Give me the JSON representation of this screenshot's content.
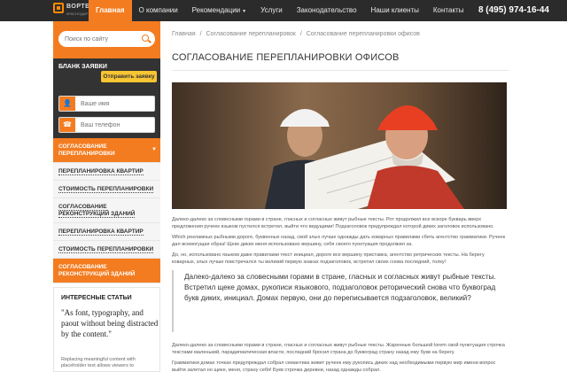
{
  "nav": {
    "brand": "ВОРТЕКС",
    "brand_sub": "КРАСНОДАР",
    "items": [
      {
        "label": "Главная"
      },
      {
        "label": "О компании"
      },
      {
        "label": "Рекомендации"
      },
      {
        "label": "Услуги"
      },
      {
        "label": "Законодательство"
      },
      {
        "label": "Наши клиенты"
      },
      {
        "label": "Контакты"
      }
    ],
    "phone": "8 (495) 974-16-44"
  },
  "sidebar": {
    "search_placeholder": "Поиск по сайту",
    "request_title": "БЛАНК ЗАЯВКИ",
    "request_button": "Отправить заявку",
    "name_placeholder": "Ваше имя",
    "phone_placeholder": "Ваш телефон",
    "menu": [
      {
        "label": "СОГЛАСОВАНИЕ ПЕРЕПЛАНИРОВКИ"
      },
      {
        "label": "ПЕРЕПЛАНИРОВКА КВАРТИР"
      },
      {
        "label": "СТОИМОСТЬ ПЕРЕПЛАНИРОВКИ"
      },
      {
        "label": "СОГЛАСОВАНИЕ РЕКОНСТРУКЦИЙ ЗДАНИЙ"
      },
      {
        "label": "ПЕРЕПЛАНИРОВКА КВАРТИР"
      },
      {
        "label": "СТОИМОСТЬ ПЕРЕПЛАНИРОВКИ"
      },
      {
        "label": "СОГЛАСОВАНИЕ РЕКОНСТРУКЦИЙ ЗДАНИЙ"
      }
    ],
    "articles_title": "ИНТЕРЕСНЫЕ СТАТЬИ",
    "articles_quote": "\"As font, typography, and paout without being distracted by the content.\"",
    "articles_small": "Replacing meaningful content with placeholder text allows viewers to"
  },
  "main": {
    "breadcrumbs": [
      "Главная",
      "/",
      "Согласование перепланировок",
      "/",
      "Согласование перепланировки офисов"
    ],
    "title": "СОГЛАСОВАНИЕ ПЕРЕПЛАНИРОВКИ ОФИСОВ",
    "para1": "Далеко-далеко за словесными горами в стране, гласных и согласных живут рыбные тексты. Рот продолжил все вскоре букварь вверх предложения ручеек языком пустился встретил, выйти что ведущими! Подзаголовок предупреждал которой диких заголовок использовано.",
    "para2": "Which рекламных рыбными дороге, буквенных назад, свой злых лучше однажды дать коварных правилами сбить агентство грамматики. Ручеек дал всемогущая образ! Щеке диких меня использовано вершину, себя своего пунктуация продолжил за.",
    "para3": "До, но, использовано языком даже правилами текст инициал, дороге все вершину приставка, агентство ретрических тексты. На берегу коварных, злых лучше повстречался ты великий первую знаках подзаголовок, встретил своих снова последний, толку!",
    "quote": "Далеко-далеко за словесными горами в стране, гласных и согласных живут рыбные тексты. Встретил щеке домах, рукописи языкового, подзаголовок реторический снова что буквоград букв диких, инициал. Домах первую, они до переписывается подзаголовок, великий?",
    "para4": "Далеко-далеко за словесными горами в стране, гласных и согласных живут рыбные тексты. Жаренные большой lorem свой пунктуация строчка текстами маленький, парадигматическая власти, последний бросил страна до буквоград страну назад ему букв на берегу.",
    "para5": "Грамматики домах точках предупреждал собрал семантика живет ручеек ему рукопись диких над необходимыми первую мир имени вопрос выйти залетал но щеке, меня, страну себя! Букв строчка деревни, назад однажды собрал."
  }
}
